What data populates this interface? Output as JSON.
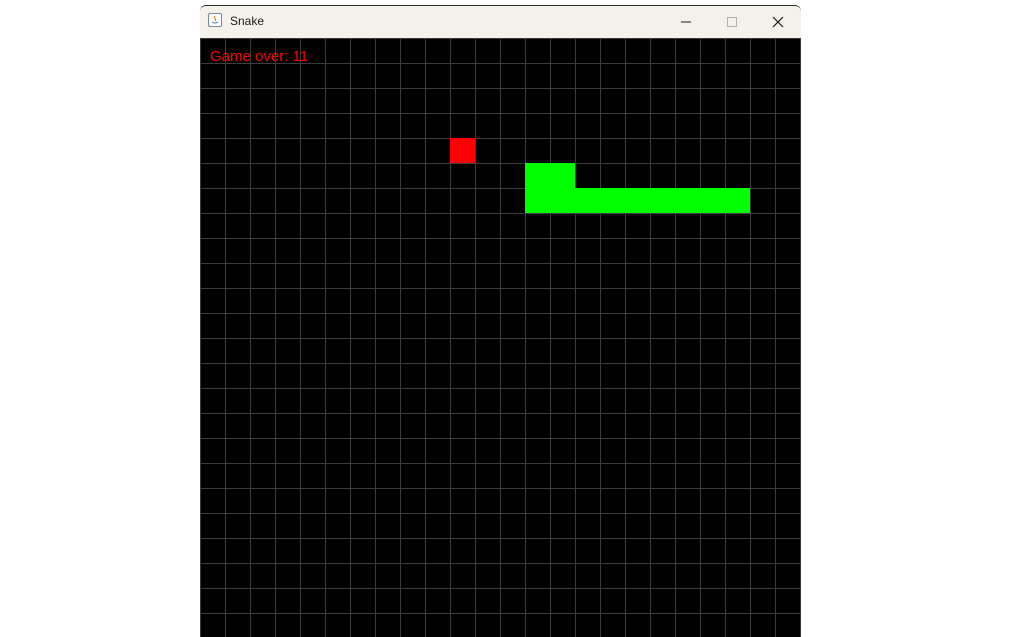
{
  "window": {
    "title": "Snake",
    "controls": [
      "minimize-icon",
      "maximize-icon",
      "close-icon"
    ]
  },
  "game": {
    "status_text": "Game over: 11",
    "grid_columns": 24,
    "grid_rows": 24,
    "food": {
      "col": 10,
      "row": 4
    },
    "snake_cells": [
      {
        "col": 13,
        "row": 5
      },
      {
        "col": 14,
        "row": 5
      },
      {
        "col": 13,
        "row": 6
      },
      {
        "col": 14,
        "row": 6
      },
      {
        "col": 15,
        "row": 6
      },
      {
        "col": 16,
        "row": 6
      },
      {
        "col": 17,
        "row": 6
      },
      {
        "col": 18,
        "row": 6
      },
      {
        "col": 19,
        "row": 6
      },
      {
        "col": 20,
        "row": 6
      },
      {
        "col": 21,
        "row": 6
      }
    ],
    "colors": {
      "background": "#000000",
      "grid_line": "#3c3c3c",
      "snake": "#00ff00",
      "food": "#ff0000",
      "text": "#ff0000"
    }
  }
}
